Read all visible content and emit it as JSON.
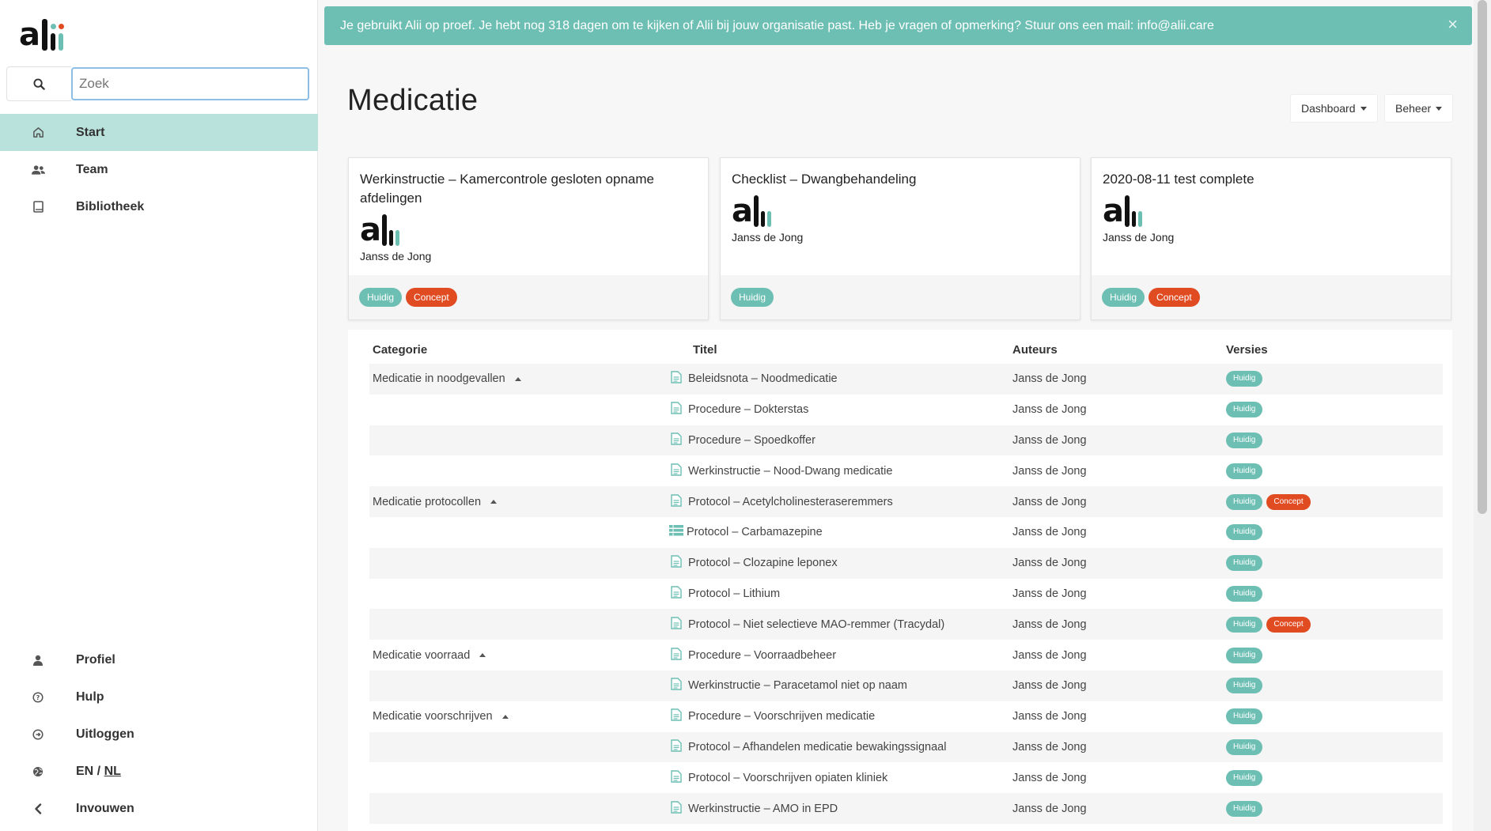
{
  "brand": {
    "logo_text": "alii",
    "accent": "#6dbfb3",
    "accent_light": "#b8e2db",
    "concept_color": "#e04b22"
  },
  "search": {
    "placeholder": "Zoek"
  },
  "sidebar": {
    "items": [
      {
        "label": "Start",
        "icon": "home-icon",
        "active": true
      },
      {
        "label": "Team",
        "icon": "users-icon"
      },
      {
        "label": "Bibliotheek",
        "icon": "book-icon"
      }
    ],
    "bottom_items": [
      {
        "label": "Profiel",
        "icon": "user-icon"
      },
      {
        "label": "Hulp",
        "icon": "help-icon"
      },
      {
        "label": "Uitloggen",
        "icon": "logout-icon"
      },
      {
        "label_en": "EN",
        "label_sep": " / ",
        "label_nl": "NL",
        "icon": "globe-icon"
      },
      {
        "label": "Invouwen",
        "icon": "chevron-left-icon"
      }
    ]
  },
  "banner": {
    "text": "Je gebruikt Alii op proef. Je hebt nog 318 dagen om te kijken of Alii bij jouw organisatie past. Heb je vragen of opmerking? Stuur ons een mail: info@alii.care",
    "close": "×"
  },
  "page": {
    "title": "Medicatie",
    "dashboard_btn": "Dashboard",
    "beheer_btn": "Beheer"
  },
  "cards": [
    {
      "title": "Werkinstructie – Kamercontrole gesloten opname afdelingen",
      "author": "Janss de Jong",
      "badges": [
        "Huidig",
        "Concept"
      ]
    },
    {
      "title": "Checklist – Dwangbehandeling",
      "author": "Janss de Jong",
      "badges": [
        "Huidig"
      ]
    },
    {
      "title": "2020-08-11 test complete",
      "author": "Janss de Jong",
      "badges": [
        "Huidig"
      ],
      "badges2": [
        "Concept"
      ]
    }
  ],
  "table": {
    "headers": {
      "categorie": "Categorie",
      "titel": "Titel",
      "auteurs": "Auteurs",
      "versies": "Versies"
    },
    "rows": [
      {
        "category": "Medicatie in noodgevallen",
        "title": "Beleidsnota – Noodmedicatie",
        "author": "Janss de Jong",
        "icon": "document-icon",
        "badges": [
          "Huidig"
        ]
      },
      {
        "category": "",
        "title": "Procedure – Dokterstas",
        "author": "Janss de Jong",
        "icon": "document-icon",
        "badges": [
          "Huidig"
        ]
      },
      {
        "category": "",
        "title": "Procedure – Spoedkoffer",
        "author": "Janss de Jong",
        "icon": "document-icon",
        "badges": [
          "Huidig"
        ]
      },
      {
        "category": "",
        "title": "Werkinstructie – Nood-Dwang medicatie",
        "author": "Janss de Jong",
        "icon": "document-icon",
        "badges": [
          "Huidig"
        ]
      },
      {
        "category": "Medicatie protocollen",
        "title": "Protocol – Acetylcholinesteraseremmers",
        "author": "Janss de Jong",
        "icon": "document-icon",
        "badges": [
          "Huidig",
          "Concept"
        ]
      },
      {
        "category": "",
        "title": "Protocol – Carbamazepine",
        "author": "Janss de Jong",
        "icon": "table-icon",
        "badges": [
          "Huidig"
        ]
      },
      {
        "category": "",
        "title": "Protocol – Clozapine leponex",
        "author": "Janss de Jong",
        "icon": "document-icon",
        "badges": [
          "Huidig"
        ]
      },
      {
        "category": "",
        "title": "Protocol – Lithium",
        "author": "Janss de Jong",
        "icon": "document-icon",
        "badges": [
          "Huidig"
        ]
      },
      {
        "category": "",
        "title": "Protocol – Niet selectieve MAO-remmer (Tracydal)",
        "author": "Janss de Jong",
        "icon": "document-icon",
        "badges": [
          "Huidig",
          "Concept"
        ]
      },
      {
        "category": "Medicatie voorraad",
        "title": "Procedure – Voorraadbeheer",
        "author": "Janss de Jong",
        "icon": "document-icon",
        "badges": [
          "Huidig"
        ]
      },
      {
        "category": "",
        "title": "Werkinstructie – Paracetamol niet op naam",
        "author": "Janss de Jong",
        "icon": "document-icon",
        "badges": [
          "Huidig"
        ]
      },
      {
        "category": "Medicatie voorschrijven",
        "title": "Procedure – Voorschrijven medicatie",
        "author": "Janss de Jong",
        "icon": "document-icon",
        "badges": [
          "Huidig"
        ]
      },
      {
        "category": "",
        "title": "Protocol – Afhandelen medicatie bewakingssignaal",
        "author": "Janss de Jong",
        "icon": "document-icon",
        "badges": [
          "Huidig"
        ]
      },
      {
        "category": "",
        "title": "Protocol – Voorschrijven opiaten kliniek",
        "author": "Janss de Jong",
        "icon": "document-icon",
        "badges": [
          "Huidig"
        ]
      },
      {
        "category": "",
        "title": "Werkinstructie – AMO in EPD",
        "author": "Janss de Jong",
        "icon": "document-icon",
        "badges": [
          "Huidig"
        ]
      }
    ]
  }
}
